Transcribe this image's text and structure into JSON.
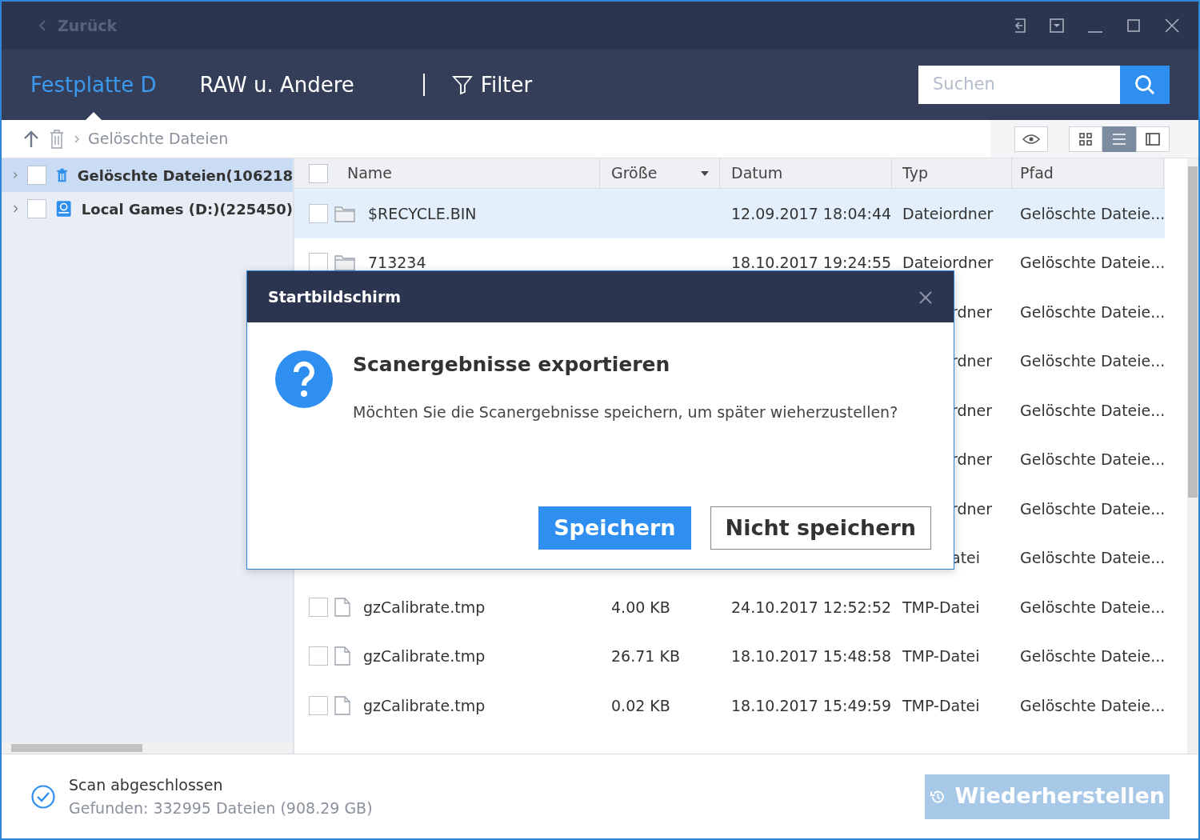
{
  "title_bar": {
    "back": "Zurück"
  },
  "tabs": [
    {
      "label": "Festplatte D",
      "selected": true
    },
    {
      "label": "RAW u. Andere",
      "selected": false
    }
  ],
  "filter": "Filter",
  "search": {
    "placeholder": "Suchen"
  },
  "breadcrumb": "Gelöschte Dateien",
  "view_modes": [
    {
      "kind": "grid",
      "selected": false
    },
    {
      "kind": "list",
      "selected": true
    },
    {
      "kind": "detail",
      "selected": false
    }
  ],
  "tree": [
    {
      "label": "Gelöschte Dateien(106218",
      "kind": "trash",
      "selected": true,
      "checked": false
    },
    {
      "label": "Local Games (D:)(225450)",
      "kind": "drive",
      "selected": false,
      "checked": false
    }
  ],
  "table": {
    "all_checked": false,
    "columns": [
      "Name",
      "Größe",
      "Datum",
      "Typ",
      "Pfad"
    ],
    "rows": [
      {
        "kind": "folder",
        "selected": true,
        "checked": false,
        "name": "$RECYCLE.BIN",
        "size": "",
        "date": "12.09.2017 18:04:44",
        "type": "Dateiordner",
        "path": "Gelöschte Dateie..."
      },
      {
        "kind": "folder",
        "selected": false,
        "checked": false,
        "name": "713234",
        "size": "",
        "date": "18.10.2017 19:24:55",
        "type": "Dateiordner",
        "path": "Gelöschte Dateie..."
      },
      {
        "kind": "covered",
        "selected": false,
        "type": "rdner",
        "path": "Gelöschte Dateie..."
      },
      {
        "kind": "covered",
        "selected": false,
        "type": "rdner",
        "path": "Gelöschte Dateie..."
      },
      {
        "kind": "covered",
        "selected": false,
        "type": "rdner",
        "path": "Gelöschte Dateie..."
      },
      {
        "kind": "covered",
        "selected": false,
        "type": "rdner",
        "path": "Gelöschte Dateie..."
      },
      {
        "kind": "covered",
        "selected": false,
        "type": "rdner",
        "path": "Gelöschte Dateie..."
      },
      {
        "kind": "covered",
        "selected": false,
        "type": "atei",
        "path": "Gelöschte Dateie..."
      },
      {
        "kind": "file",
        "selected": false,
        "name": "gzCalibrate.tmp",
        "checked": false,
        "size": "4.00 KB",
        "date": "24.10.2017 12:52:52",
        "type": "TMP-Datei",
        "path": "Gelöschte Dateie..."
      },
      {
        "kind": "file",
        "selected": false,
        "name": "gzCalibrate.tmp",
        "checked": false,
        "size": "26.71 KB",
        "date": "18.10.2017 15:48:58",
        "type": "TMP-Datei",
        "path": "Gelöschte Dateie..."
      },
      {
        "kind": "file",
        "selected": false,
        "name": "gzCalibrate.tmp",
        "checked": false,
        "size": "0.02 KB",
        "date": "18.10.2017 15:49:59",
        "type": "TMP-Datei",
        "path": "Gelöschte Dateie..."
      }
    ]
  },
  "status": {
    "title": "Scan abgeschlossen",
    "detail": "Gefunden: 332995 Dateien (908.29 GB)"
  },
  "recover_button": {
    "label": "Wiederherstellen",
    "disabled": true
  },
  "dialog": {
    "title": "Startbildschirm",
    "heading": "Scanergebnisse exportieren",
    "message": "Möchten Sie die Scanergebnisse speichern, um später wieherzustellen?",
    "buttons": [
      {
        "label": "Speichern",
        "kind": "primary"
      },
      {
        "label": "Nicht speichern",
        "kind": "secondary"
      }
    ]
  }
}
